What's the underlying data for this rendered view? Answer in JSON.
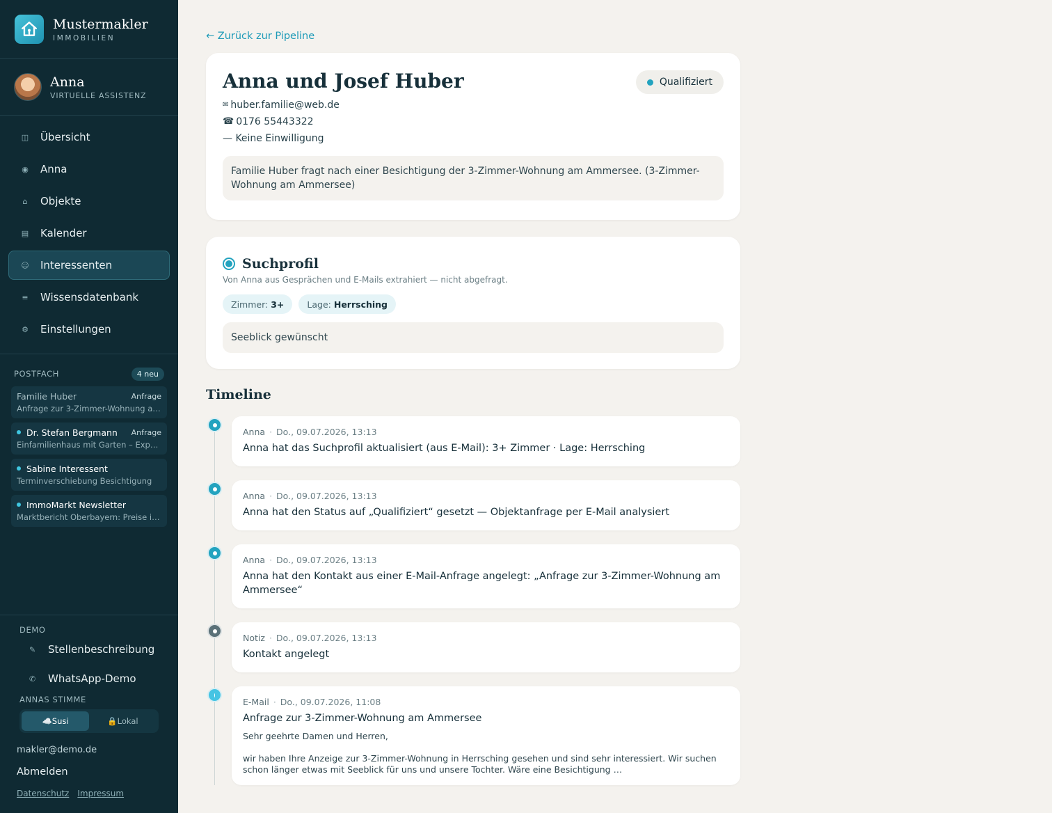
{
  "brand": {
    "name": "Mustermakler",
    "sub": "IMMOBILIEN"
  },
  "assistant": {
    "name": "Anna",
    "role": "VIRTUELLE ASSISTENZ"
  },
  "nav": [
    {
      "icon": "◫",
      "label": "Übersicht"
    },
    {
      "icon": "◉",
      "label": "Anna"
    },
    {
      "icon": "⌂",
      "label": "Objekte"
    },
    {
      "icon": "▤",
      "label": "Kalender"
    },
    {
      "icon": "☺",
      "label": "Interessenten"
    },
    {
      "icon": "≡",
      "label": "Wissensdatenbank"
    },
    {
      "icon": "⚙",
      "label": "Einstellungen"
    }
  ],
  "inbox": {
    "title": "POSTFACH",
    "badge": "4 neu",
    "items": [
      {
        "sender": "Familie Huber",
        "tag": "Anfrage",
        "subject": "Anfrage zur 3-Zimmer-Wohnung a…"
      },
      {
        "sender": "Dr. Stefan Bergmann",
        "tag": "Anfrage",
        "subject": "Einfamilienhaus mit Garten – Expos…"
      },
      {
        "sender": "Sabine Interessent",
        "tag": "",
        "subject": "Terminverschiebung Besichtigung"
      },
      {
        "sender": "ImmoMarkt Newsletter",
        "tag": "",
        "subject": "Marktbericht Oberbayern: Preise im…"
      }
    ]
  },
  "demo": {
    "title": "DEMO",
    "items": [
      {
        "icon": "✎",
        "label": "Stellenbeschreibung"
      },
      {
        "icon": "✆",
        "label": "WhatsApp-Demo"
      }
    ]
  },
  "voice": {
    "title": "ANNAS STIMME",
    "opt1": "☁️Susi",
    "opt2": "🔒Lokal"
  },
  "account": {
    "email": "makler@demo.de",
    "logout": "Abmelden",
    "privacy": "Datenschutz",
    "imprint": "Impressum"
  },
  "main": {
    "back": "← Zurück zur Pipeline",
    "contact": {
      "name": "Anna und Josef Huber",
      "status": "Qualifiziert",
      "email_icon": "✉",
      "email": "huber.familie@web.de",
      "phone_icon": "☎",
      "phone": "0176 55443322",
      "consent": "— Keine Einwilligung",
      "note": "Familie Huber fragt nach einer Besichtigung der 3-Zimmer-Wohnung am Ammersee. (3-Zimmer-Wohnung am Ammersee)"
    },
    "profile": {
      "title": "Suchprofil",
      "subtitle": "Von Anna aus Gesprächen und E-Mails extrahiert — nicht abgefragt.",
      "chips": [
        {
          "key": "Zimmer:",
          "value": "3+"
        },
        {
          "key": "Lage:",
          "value": "Herrsching"
        }
      ],
      "note": "Seeblick gewünscht"
    },
    "timeline": {
      "title": "Timeline",
      "sep": "·",
      "items": [
        {
          "who": "Anna",
          "when": "Do., 09.07.2026, 13:13",
          "text": "Anna hat das Suchprofil aktualisiert (aus E-Mail): 3+ Zimmer · Lage: Herrsching"
        },
        {
          "who": "Anna",
          "when": "Do., 09.07.2026, 13:13",
          "text": "Anna hat den Status auf „Qualifiziert“ gesetzt — Objektanfrage per E-Mail analysiert"
        },
        {
          "who": "Anna",
          "when": "Do., 09.07.2026, 13:13",
          "text": "Anna hat den Kontakt aus einer E-Mail-Anfrage angelegt: „Anfrage zur 3-Zimmer-Wohnung am Ammersee“"
        },
        {
          "who": "Notiz",
          "when": "Do., 09.07.2026, 13:13",
          "text": "Kontakt angelegt"
        },
        {
          "who": "E-Mail",
          "when": "Do., 09.07.2026, 11:08",
          "text": "Anfrage zur 3-Zimmer-Wohnung am Ammersee",
          "body1": "Sehr geehrte Damen und Herren,",
          "body2": "wir haben Ihre Anzeige zur 3-Zimmer-Wohnung in Herrsching gesehen und sind sehr interessiert. Wir suchen schon länger etwas mit Seeblick für uns und unsere Tochter. Wäre eine Besichtigung …"
        }
      ]
    }
  }
}
